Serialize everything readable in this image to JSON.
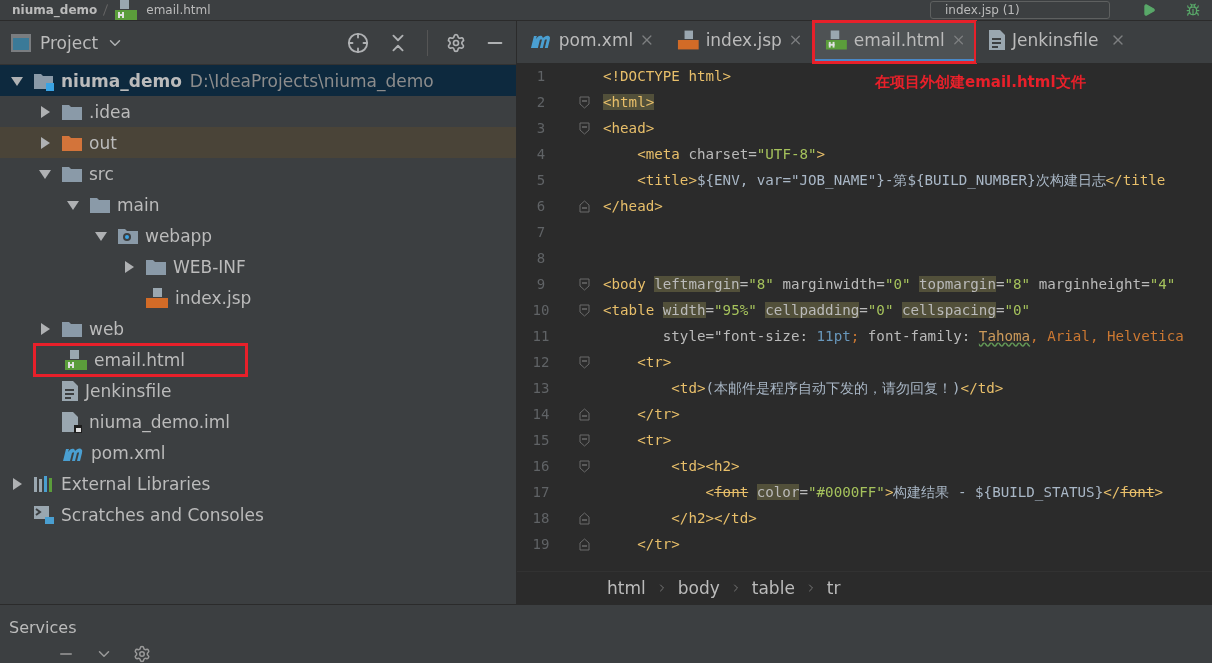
{
  "top_bar": {
    "breadcrumb": [
      "niuma_demo",
      "email.html"
    ],
    "run_config": "index.jsp (1)"
  },
  "project_panel": {
    "title": "Project",
    "tree": [
      {
        "name": "niuma_demo",
        "kind": "module",
        "hint": "D:\\IdeaProjects\\niuma_demo",
        "expanded": true,
        "selected": true,
        "children": [
          {
            "name": ".idea",
            "kind": "folder",
            "expanded": false,
            "selected": false
          },
          {
            "name": "out",
            "kind": "excluded-folder",
            "expanded": false,
            "selected": false
          },
          {
            "name": "src",
            "kind": "folder",
            "expanded": true,
            "selected": false,
            "children": [
              {
                "name": "main",
                "kind": "folder",
                "expanded": true,
                "selected": false,
                "children": [
                  {
                    "name": "webapp",
                    "kind": "web-folder",
                    "expanded": true,
                    "selected": false,
                    "children": [
                      {
                        "name": "WEB-INF",
                        "kind": "folder",
                        "expanded": false,
                        "selected": false
                      },
                      {
                        "name": "index.jsp",
                        "kind": "jsp",
                        "selected": false
                      }
                    ]
                  }
                ]
              }
            ]
          },
          {
            "name": "web",
            "kind": "folder",
            "expanded": false,
            "selected": false
          },
          {
            "name": "email.html",
            "kind": "html",
            "selected": false,
            "outlined": true
          },
          {
            "name": "Jenkinsfile",
            "kind": "text",
            "selected": false
          },
          {
            "name": "niuma_demo.iml",
            "kind": "iml",
            "selected": false
          },
          {
            "name": "pom.xml",
            "kind": "maven",
            "selected": false
          }
        ]
      },
      {
        "name": "External Libraries",
        "kind": "libraries",
        "expanded": false,
        "selected": false
      },
      {
        "name": "Scratches and Consoles",
        "kind": "scratches",
        "selected": false
      }
    ]
  },
  "editor": {
    "tabs": [
      {
        "label": "pom.xml",
        "kind": "maven",
        "selected": false
      },
      {
        "label": "index.jsp",
        "kind": "jsp",
        "selected": false
      },
      {
        "label": "email.html",
        "kind": "html",
        "selected": true,
        "outlined": true
      },
      {
        "label": "Jenkinsfile",
        "kind": "text",
        "selected": false
      }
    ],
    "note": "在项目外创建email.html文件",
    "lines": [
      {
        "number": "1",
        "kind": "plain",
        "tokens": [
          {
            "kind": "tag",
            "text": "<!DOCTYPE html>"
          }
        ]
      },
      {
        "number": "2",
        "kind": "fold-start",
        "tokens": [
          {
            "kind": "tag-hl",
            "text": "<html>"
          }
        ]
      },
      {
        "number": "3",
        "kind": "fold-start",
        "tokens": [
          {
            "kind": "tag",
            "text": "<head>"
          }
        ]
      },
      {
        "number": "4",
        "kind": "plain",
        "tokens": [
          {
            "kind": "tag",
            "text": "    <meta "
          },
          {
            "kind": "attr",
            "text": "charset="
          },
          {
            "kind": "value",
            "text": "\"UTF-8\""
          },
          {
            "kind": "tag",
            "text": ">"
          }
        ]
      },
      {
        "number": "5",
        "kind": "plain",
        "tokens": [
          {
            "kind": "tag",
            "text": "    <title>"
          },
          {
            "kind": "text",
            "text": "${ENV, var=\"JOB_NAME\"}-第${BUILD_NUMBER}次构建日志"
          },
          {
            "kind": "tag",
            "text": "</title"
          }
        ]
      },
      {
        "number": "6",
        "kind": "fold-end",
        "tokens": [
          {
            "kind": "tag",
            "text": "</head>"
          }
        ]
      },
      {
        "number": "7",
        "kind": "plain"
      },
      {
        "number": "8",
        "kind": "plain"
      },
      {
        "number": "9",
        "kind": "fold-start",
        "tokens": [
          {
            "kind": "tag",
            "text": "<body "
          },
          {
            "kind": "attr-hl",
            "text": "leftmargin"
          },
          {
            "kind": "attr",
            "text": "="
          },
          {
            "kind": "value",
            "text": "\"8\" "
          },
          {
            "kind": "attr",
            "text": "marginwidth="
          },
          {
            "kind": "value",
            "text": "\"0\" "
          },
          {
            "kind": "attr-hl",
            "text": "topmargin"
          },
          {
            "kind": "attr",
            "text": "="
          },
          {
            "kind": "value",
            "text": "\"8\" "
          },
          {
            "kind": "attr",
            "text": "marginheight="
          },
          {
            "kind": "value",
            "text": "\"4\""
          }
        ]
      },
      {
        "number": "10",
        "kind": "fold-start",
        "tokens": [
          {
            "kind": "tag",
            "text": "<table "
          },
          {
            "kind": "attr-hl",
            "text": "width"
          },
          {
            "kind": "attr",
            "text": "="
          },
          {
            "kind": "value",
            "text": "\"95%\" "
          },
          {
            "kind": "attr-hl",
            "text": "cellpadding"
          },
          {
            "kind": "attr",
            "text": "="
          },
          {
            "kind": "value",
            "text": "\"0\" "
          },
          {
            "kind": "attr-hl",
            "text": "cellspacing"
          },
          {
            "kind": "attr",
            "text": "="
          },
          {
            "kind": "value",
            "text": "\"0\""
          }
        ]
      },
      {
        "number": "11",
        "kind": "plain",
        "tokens": [
          {
            "kind": "attr",
            "text": "       style=\"font-size: "
          },
          {
            "kind": "number",
            "text": "11pt"
          },
          {
            "kind": "punct",
            "text": "; "
          },
          {
            "kind": "attr",
            "text": "font-family: "
          },
          {
            "kind": "typo",
            "text": "Tahoma"
          },
          {
            "kind": "punct",
            "text": ", Arial, Helvetica"
          }
        ]
      },
      {
        "number": "12",
        "kind": "fold-start",
        "tokens": [
          {
            "kind": "tag",
            "text": "    <tr>"
          }
        ]
      },
      {
        "number": "13",
        "kind": "plain",
        "tokens": [
          {
            "kind": "tag",
            "text": "        <td>"
          },
          {
            "kind": "text",
            "text": "(本邮件是程序自动下发的，请勿回复！)"
          },
          {
            "kind": "tag",
            "text": "</td>"
          }
        ]
      },
      {
        "number": "14",
        "kind": "fold-end",
        "tokens": [
          {
            "kind": "tag",
            "text": "    </tr>"
          }
        ]
      },
      {
        "number": "15",
        "kind": "fold-start",
        "tokens": [
          {
            "kind": "tag",
            "text": "    <tr>"
          }
        ]
      },
      {
        "number": "16",
        "kind": "fold-start",
        "tokens": [
          {
            "kind": "tag",
            "text": "        <td><h2>"
          }
        ]
      },
      {
        "number": "17",
        "kind": "plain",
        "tokens": [
          {
            "kind": "tag",
            "text": "            <"
          },
          {
            "kind": "tag-strike",
            "text": "font"
          },
          {
            "kind": "attr-hl",
            "text": "color"
          },
          {
            "kind": "attr",
            "text": "="
          },
          {
            "kind": "value",
            "text": "\"#0000FF\""
          },
          {
            "kind": "tag",
            "text": ">"
          },
          {
            "kind": "text",
            "text": "构建结果 - ${BUILD_STATUS}"
          },
          {
            "kind": "tag",
            "text": "</"
          },
          {
            "kind": "tag-strike",
            "text": "font"
          },
          {
            "kind": "tag",
            "text": ">"
          }
        ]
      },
      {
        "number": "18",
        "kind": "fold-end",
        "tokens": [
          {
            "kind": "tag",
            "text": "        </h2></td>"
          }
        ]
      },
      {
        "number": "19",
        "kind": "fold-end",
        "tokens": [
          {
            "kind": "tag",
            "text": "    </tr>"
          }
        ]
      }
    ],
    "breadcrumb": [
      "html",
      "body",
      "table",
      "tr"
    ]
  },
  "services": {
    "title": "Services"
  }
}
